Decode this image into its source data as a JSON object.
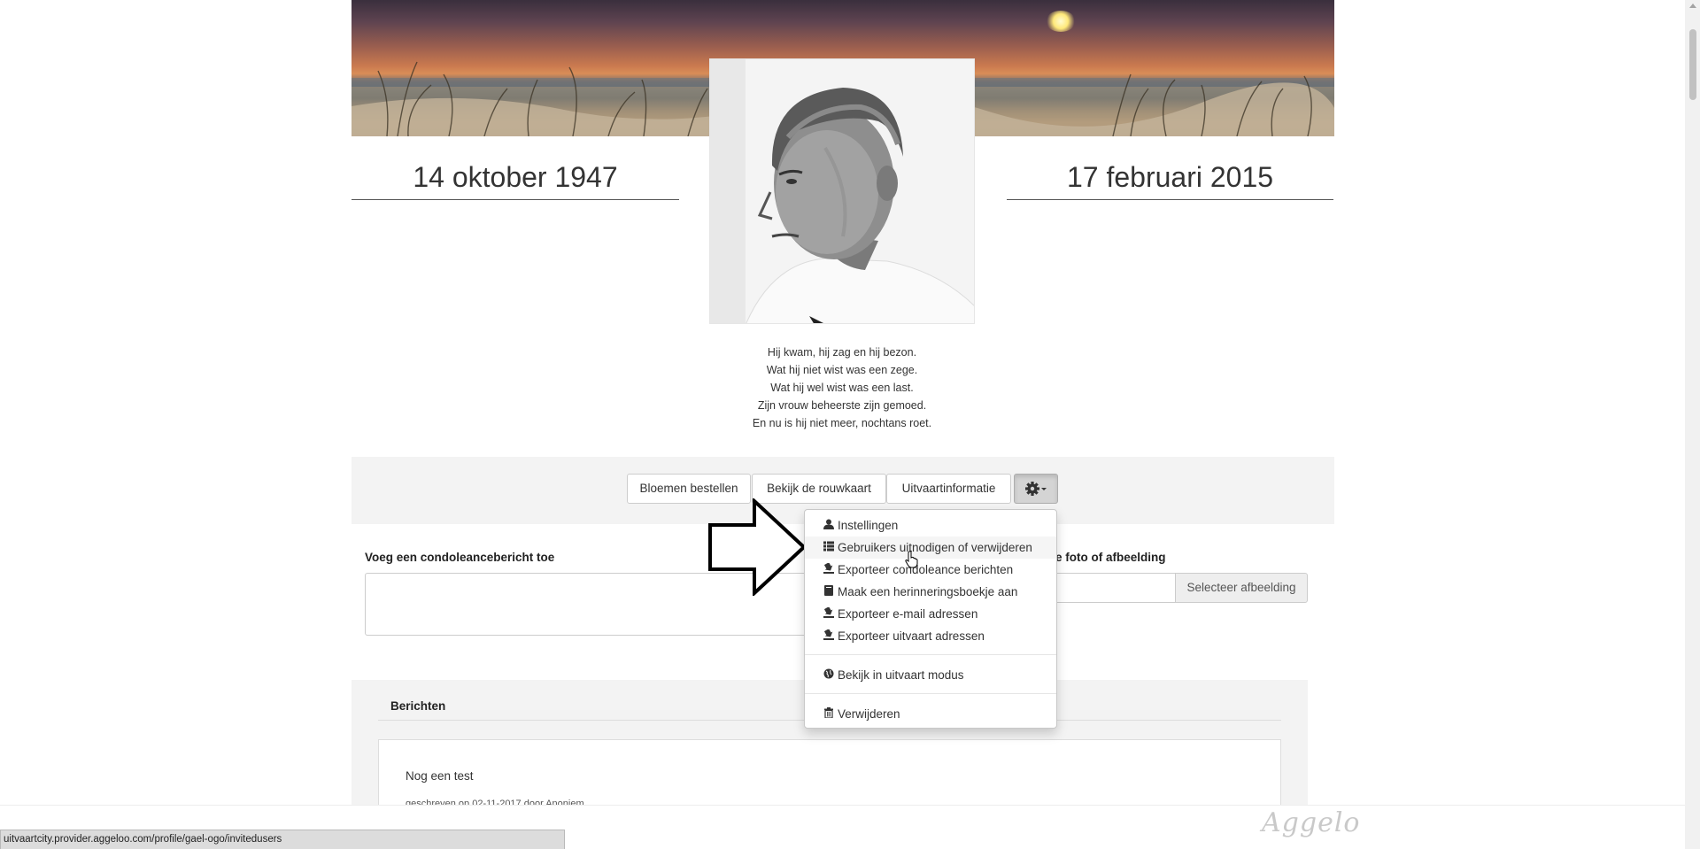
{
  "dates": {
    "birth": "14 oktober 1947",
    "death": "17 februari 2015"
  },
  "poem": {
    "lines": [
      "Hij kwam, hij zag en hij bezon.",
      "Wat hij niet wist was een zege.",
      "Wat hij wel wist was een last.",
      "Zijn vrouw beheerste zijn gemoed.",
      "En nu is hij niet meer, nochtans roet."
    ]
  },
  "toolbar": {
    "flowers_label": "Bloemen bestellen",
    "card_label": "Bekijk de rouwkaart",
    "info_label": "Uitvaartinformatie",
    "settings_icon": "gear-icon"
  },
  "dropdown": {
    "items": [
      {
        "label": "Instellingen",
        "icon": "user-icon"
      },
      {
        "label": "Gebruikers uitnodigen of verwijderen",
        "icon": "list-icon"
      },
      {
        "label": "Exporteer condoleance berichten",
        "icon": "export-icon"
      },
      {
        "label": "Maak een herinneringsboekje aan",
        "icon": "book-icon"
      },
      {
        "label": "Exporteer e-mail adressen",
        "icon": "export-icon"
      },
      {
        "label": "Exporteer uitvaart adressen",
        "icon": "export-icon"
      },
      {
        "label": "Bekijk in uitvaart modus",
        "icon": "globe-icon"
      },
      {
        "label": "Verwijderen",
        "icon": "trash-icon"
      }
    ]
  },
  "form": {
    "condolence_label": "Voeg een condoleancebericht toe",
    "photo_label_visible": "oie foto of afbeelding",
    "select_image_label": "Selecteer afbeelding"
  },
  "messages": {
    "title": "Berichten",
    "items": [
      {
        "title": "Nog een test",
        "meta": "geschreven op 02-11-2017 door Anoniem"
      }
    ]
  },
  "footer": {
    "logo_text": "Aggelo",
    "status_url": "uitvaartcity.provider.aggeloo.com/profile/gael-ogo/invitedusers"
  },
  "colors": {
    "panel_bg": "#f3f3f3",
    "gear_active_bg": "#d4d4d4",
    "hover_bg": "#f5f5f5"
  }
}
